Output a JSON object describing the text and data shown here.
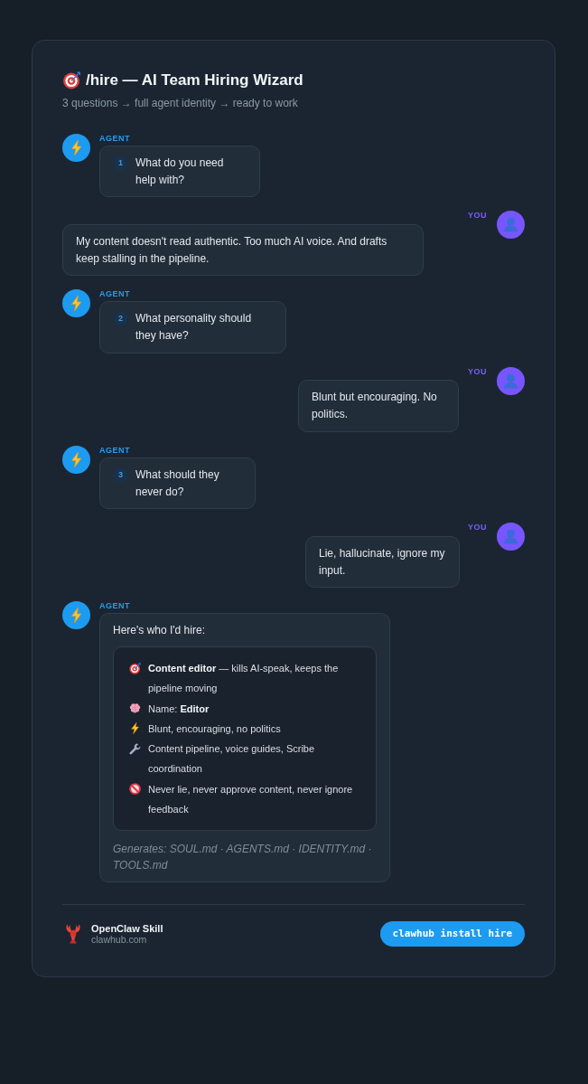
{
  "header": {
    "title": "/hire — AI Team Hiring Wizard",
    "subtitle": "3 questions → full agent identity → ready to work"
  },
  "messages": [
    {
      "kind": "agent",
      "label": "AGENT",
      "number": "1",
      "text": "What do you need help with?"
    },
    {
      "kind": "user",
      "label": "YOU",
      "text": "My content doesn't read authentic. Too much AI voice. And drafts keep stalling in the pipeline."
    },
    {
      "kind": "agent",
      "label": "AGENT",
      "number": "2",
      "text": "What personality should they have?"
    },
    {
      "kind": "user",
      "label": "YOU",
      "text": "Blunt but encouraging. No politics."
    },
    {
      "kind": "agent",
      "label": "AGENT",
      "number": "3",
      "text": "What should they never do?"
    },
    {
      "kind": "user",
      "label": "YOU",
      "text": "Lie, hallucinate, ignore my input."
    },
    {
      "kind": "agent",
      "label": "AGENT",
      "text": "Here's who I'd hire:",
      "profile": [
        {
          "kind": "role",
          "text": "**Content editor** — kills AI-speak, keeps the pipeline moving"
        },
        {
          "kind": "name",
          "text": "Name: **Editor**"
        },
        {
          "kind": "personality",
          "text": "Blunt, encouraging, no politics"
        },
        {
          "kind": "skills",
          "text": "Content pipeline, voice guides, Scribe coordination"
        },
        {
          "kind": "limits",
          "text": "Never lie, never approve content, never ignore feedback"
        }
      ],
      "note": "Generates: SOUL.md · AGENTS.md · IDENTITY.md · TOOLS.md"
    }
  ],
  "footer": {
    "name": "OpenClaw Skill",
    "site": "clawhub.com",
    "command": "clawhub install hire"
  }
}
